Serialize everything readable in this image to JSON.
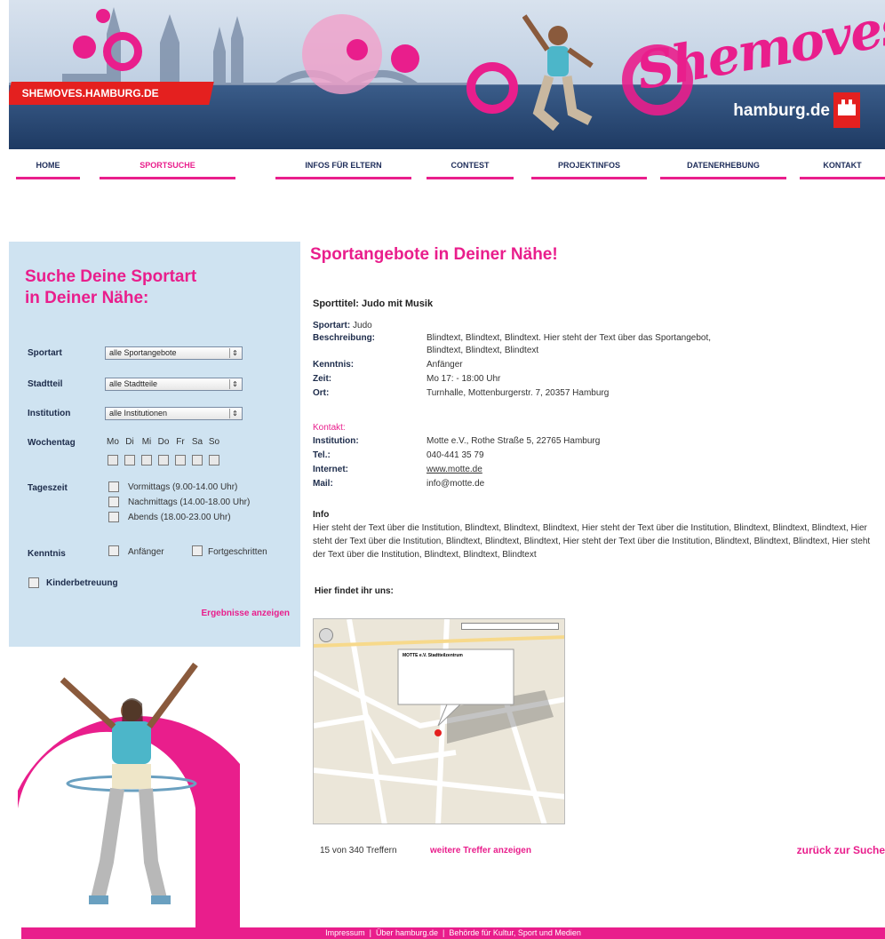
{
  "header": {
    "site_badge": "SHEMOVES.HAMBURG.DE",
    "logo": "Shemoves",
    "partner": "hamburg.de",
    "colors": {
      "accent": "#e91e8c",
      "red": "#e4201f",
      "navy": "#1e2d5a"
    }
  },
  "nav": {
    "items": [
      {
        "label": "HOME"
      },
      {
        "label": "SPORTSUCHE"
      },
      {
        "label": "INFOS FÜR ELTERN"
      },
      {
        "label": "CONTEST"
      },
      {
        "label": "PROJEKTINFOS"
      },
      {
        "label": "DATENERHEBUNG"
      },
      {
        "label": "KONTAKT"
      }
    ],
    "active": "SPORTSUCHE"
  },
  "sidebar": {
    "title_line1": "Suche Deine Sportart",
    "title_line2": "in Deiner Nähe:",
    "sportart_label": "Sportart",
    "sportart_value": "alle Sportangebote",
    "stadtteil_label": "Stadtteil",
    "stadtteil_value": "alle Stadtteile",
    "institution_label": "Institution",
    "institution_value": "alle Institutionen",
    "wochentag_label": "Wochentag",
    "days": [
      "Mo",
      "Di",
      "Mi",
      "Do",
      "Fr",
      "Sa",
      "So"
    ],
    "tageszeit_label": "Tageszeit",
    "tageszeit_options": [
      "Vormittags (9.00-14.00 Uhr)",
      "Nachmittags (14.00-18.00 Uhr)",
      "Abends (18.00-23.00 Uhr)"
    ],
    "kenntnis_label": "Kenntnis",
    "kenntnis_options": [
      "Anfänger",
      "Fortgeschritten"
    ],
    "kinderbetreuung": "Kinderbetreuung",
    "results_link": "Ergebnisse anzeigen"
  },
  "main": {
    "title": "Sportangebote in Deiner Nähe!",
    "sport_title": "Sporttitel: Judo mit Musik",
    "sportart_label": "Sportart:",
    "sportart_value": "Judo",
    "beschreibung_label": "Beschreibung:",
    "beschreibung_value_1": "Blindtext, Blindtext, Blindtext. Hier steht der Text über das Sportangebot,",
    "beschreibung_value_2": "Blindtext, Blindtext, Blindtext",
    "kenntnis_label": "Kenntnis:",
    "kenntnis_value": "Anfänger",
    "zeit_label": "Zeit:",
    "zeit_value": "Mo 17: - 18:00 Uhr",
    "ort_label": "Ort:",
    "ort_value": "Turnhalle, Mottenburgerstr. 7, 20357 Hamburg",
    "kontakt_label": "Kontakt:",
    "institution_label": "Institution:",
    "institution_value": "Motte e.V., Rothe Straße 5, 22765 Hamburg",
    "tel_label": "Tel.:",
    "tel_value": "040-441 35 79",
    "internet_label": "Internet:",
    "internet_value": "www.motte.de",
    "mail_label": "Mail:",
    "mail_value": "info@motte.de",
    "info_label": "Info",
    "info_text": "Hier steht der Text über die Institution, Blindtext, Blindtext, Blindtext, Hier steht der Text über die Institution, Blindtext, Blindtext, Blindtext, Hier steht der Text über die Institution, Blindtext, Blindtext, Blindtext, Hier steht der Text über die Institution, Blindtext, Blindtext, Blindtext, Hier steht der Text über die Institution, Blindtext, Blindtext, Blindtext",
    "find_label": "Hier findet ihr uns:",
    "hits_text": "15 von 340 Treffern",
    "more_link": "weitere Treffer anzeigen",
    "back_link": "zurück zur Suche"
  },
  "map": {
    "popup_title": "MOTTE e.V. Stadtteilzentrum"
  },
  "footer": {
    "links": [
      "Impressum",
      "Über hamburg.de",
      "Behörde für Kultur, Sport und Medien"
    ],
    "separator": "|"
  }
}
